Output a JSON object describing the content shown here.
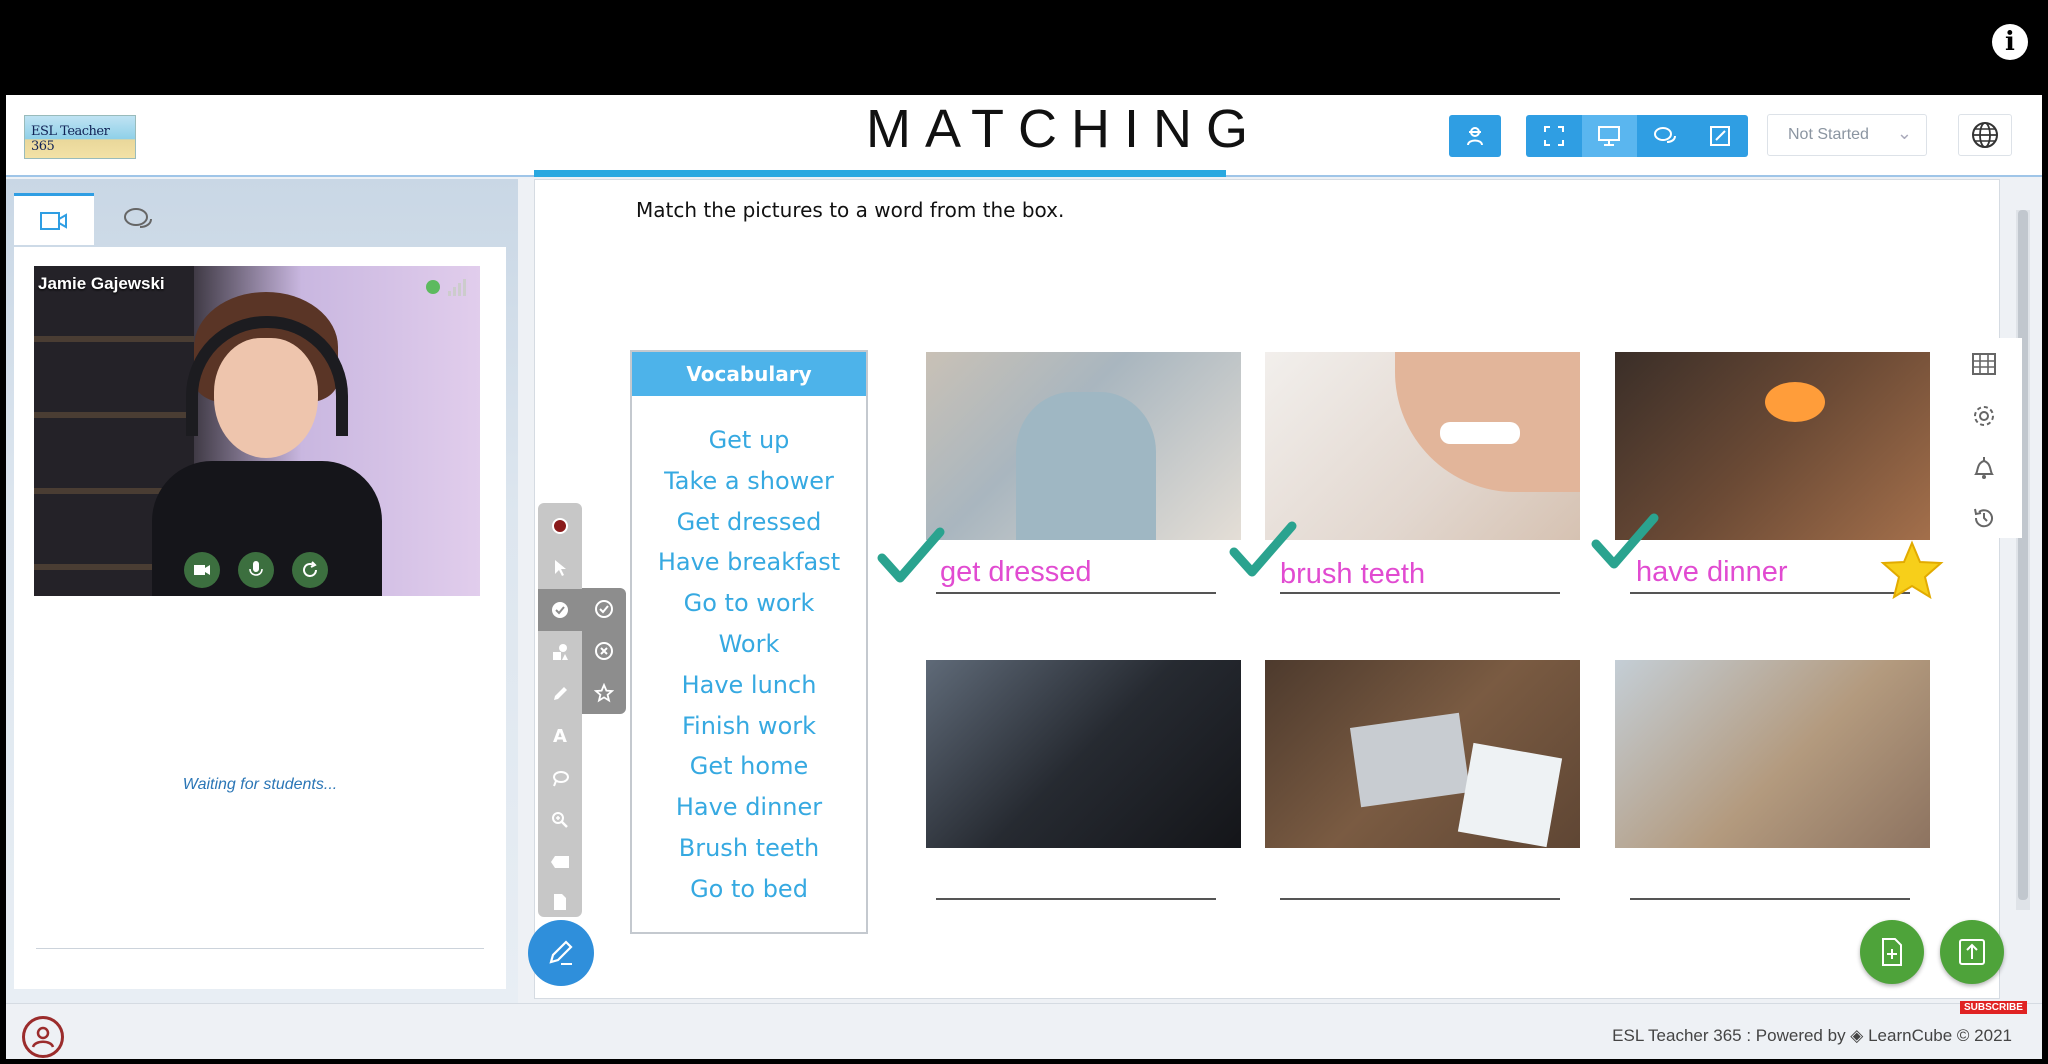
{
  "header": {
    "logo_text": "ESL Teacher 365",
    "status_select": "Not Started"
  },
  "left_panel": {
    "participant_name": "Jamie Gajewski",
    "waiting_text": "Waiting for students..."
  },
  "worksheet": {
    "title": "MATCHING",
    "instruction": "Match the pictures to a word from the box.",
    "vocab_heading": "Vocabulary",
    "vocab": [
      "Get up",
      "Take a shower",
      "Get dressed",
      "Have breakfast",
      "Go to work",
      "Work",
      "Have lunch",
      "Finish work",
      "Get home",
      "Have dinner",
      "Brush teeth",
      "Go to bed"
    ],
    "answers": [
      "get dressed",
      "brush teeth",
      "have dinner",
      "",
      "",
      ""
    ]
  },
  "toolbar_tools": [
    "record",
    "pointer",
    "stamp",
    "shapes",
    "pen",
    "text",
    "lasso",
    "zoom",
    "eraser",
    "document"
  ],
  "stamp_options": [
    "check",
    "cross",
    "star"
  ],
  "side_icons": [
    "grid-icon",
    "gear-icon",
    "bell-icon",
    "history-icon"
  ],
  "footer": {
    "powered_by": "ESL Teacher 365 : Powered by ◈ LearnCube © 2021",
    "subscribe": "SUBSCRIBE"
  },
  "colors": {
    "accent": "#2f9ee3",
    "answer": "#e14bd1",
    "check": "#2aa38f",
    "fab": "#4ea33a"
  }
}
